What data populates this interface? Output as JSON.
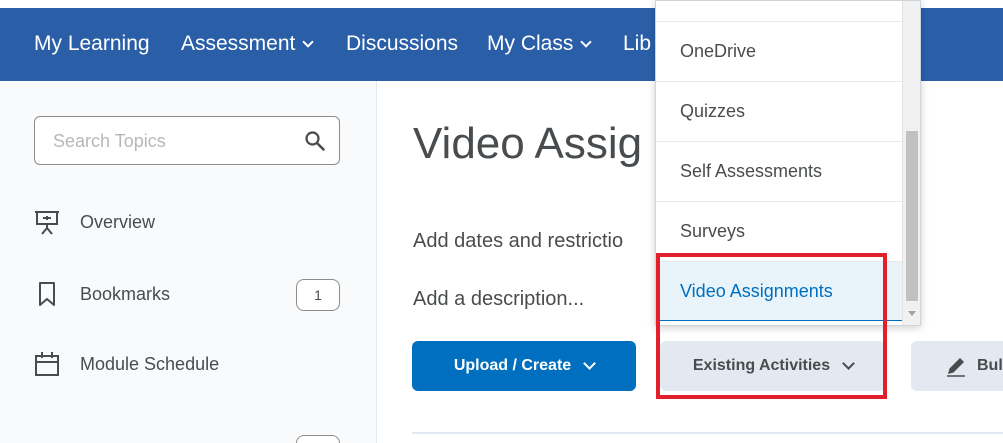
{
  "nav": {
    "items": [
      {
        "label": "My Learning",
        "has_menu": false
      },
      {
        "label": "Assessment",
        "has_menu": true
      },
      {
        "label": "Discussions",
        "has_menu": false
      },
      {
        "label": "My Class",
        "has_menu": true
      },
      {
        "label": "Lib",
        "has_menu": false
      }
    ]
  },
  "sidebar": {
    "search_placeholder": "Search Topics",
    "items": [
      {
        "label": "Overview",
        "icon": "presentation-board-icon"
      },
      {
        "label": "Bookmarks",
        "icon": "bookmark-icon",
        "count": "1"
      },
      {
        "label": "Module Schedule",
        "icon": "calendar-icon"
      }
    ]
  },
  "main": {
    "title": "Video Assig",
    "dates_link": "Add dates and restrictio",
    "description_link": "Add a description...",
    "buttons": {
      "upload": "Upload / Create",
      "existing": "Existing Activities",
      "bulk": "Bul"
    }
  },
  "dropdown": {
    "items": [
      "OneDrive",
      "Quizzes",
      "Self Assessments",
      "Surveys",
      "Video Assignments"
    ],
    "active": "Video Assignments"
  },
  "colors": {
    "nav_bg": "#2a5fa8",
    "primary": "#006fbf",
    "highlight": "#e2202b"
  }
}
